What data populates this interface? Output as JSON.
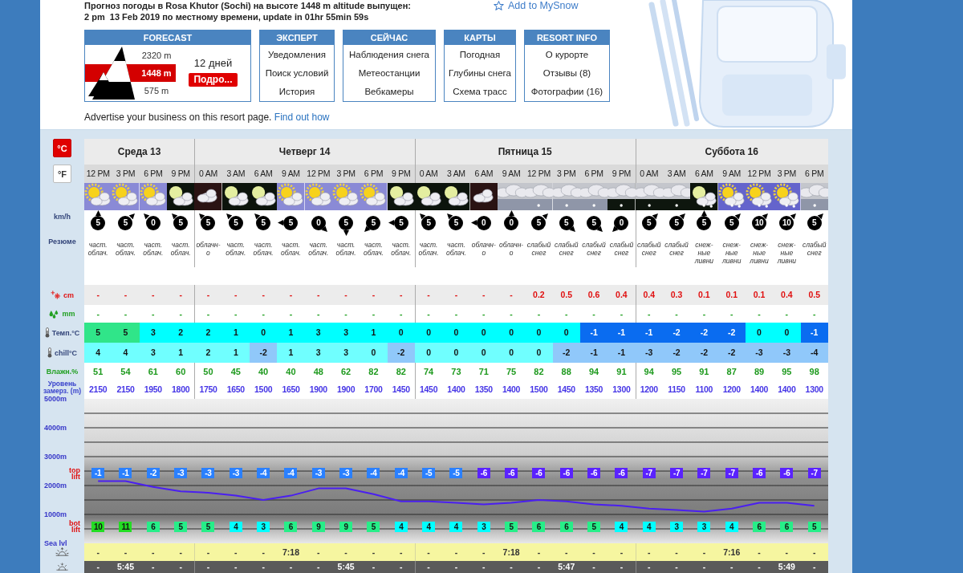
{
  "header": {
    "title": "Прогноз погоды в Rosa Khutor (Sochi) на высоте 1448 m altitude выпущен:",
    "issued": "2 pm  13 Feb 2019 по местному времени, update in 01hr 55min 59s",
    "mysnow_link": "Add to MySnow"
  },
  "forecast_box": {
    "title": "FORECAST",
    "altitudes": [
      {
        "label": "2320 m",
        "selected": false
      },
      {
        "label": "1448 m",
        "selected": true
      },
      {
        "label": "575 m",
        "selected": false
      }
    ],
    "days": "12 дней",
    "more_button": "Подро..."
  },
  "menus": [
    {
      "title": "ЭКСПЕРТ",
      "items": [
        "Уведомления",
        "Поиск условий",
        "История"
      ]
    },
    {
      "title": "СЕЙЧАС",
      "items": [
        "Наблюдения снега",
        "Метеостанции",
        "Вебкамеры"
      ]
    },
    {
      "title": "КАРТЫ",
      "items": [
        "Погодная",
        "Глубины снега",
        "Схема трасс"
      ]
    },
    {
      "title": "RESORT INFO",
      "items": [
        "О курорте",
        "Отзывы (8)",
        "Фотографии (16)"
      ]
    }
  ],
  "advert": {
    "text": "Advertise your business on this resort page.",
    "link": "Find out how"
  },
  "units": [
    {
      "label": "°C",
      "selected": true
    },
    {
      "label": "°F",
      "selected": false
    }
  ],
  "row_labels": {
    "wind": "km/h",
    "summary": "Резюме",
    "snow": "cm",
    "rain": "mm",
    "temp": "Темп.°C",
    "chill": "chill°C",
    "humidity": "Влажн.%",
    "freezing": "Уровень замерз. (m)"
  },
  "forecast": {
    "days": [
      {
        "name": "Среда 13",
        "columns": [
          {
            "time": "12 PM",
            "kind": "sun-cloud",
            "wind": {
              "speed": "5",
              "kind": "n"
            },
            "summary": "част. облач.",
            "snow": "-",
            "rain": "-",
            "temp": {
              "value": "5",
              "color": "#30e589"
            },
            "chill": {
              "value": "4",
              "color": "#70ffff"
            },
            "humidity": "51",
            "freezing": "2150"
          },
          {
            "time": "3 PM",
            "kind": "sun-cloud",
            "wind": {
              "speed": "5",
              "kind": "ne"
            },
            "summary": "част. облач.",
            "snow": "-",
            "rain": "-",
            "temp": {
              "value": "5",
              "color": "#30e589"
            },
            "chill": {
              "value": "4",
              "color": "#70ffff"
            },
            "humidity": "54",
            "freezing": "2150"
          },
          {
            "time": "6 PM",
            "kind": "sun-cloud",
            "wind": {
              "speed": "0",
              "kind": "nw"
            },
            "summary": "част. облач.",
            "snow": "-",
            "rain": "-",
            "temp": {
              "value": "3",
              "color": "#00ffff"
            },
            "chill": {
              "value": "3",
              "color": "#70ffff"
            },
            "humidity": "61",
            "freezing": "1950"
          },
          {
            "time": "9 PM",
            "kind": "moon-cloud",
            "wind": {
              "speed": "5",
              "kind": "nw"
            },
            "summary": "част. облач.",
            "snow": "-",
            "rain": "-",
            "temp": {
              "value": "2",
              "color": "#00ffff"
            },
            "chill": {
              "value": "1",
              "color": "#70ffff"
            },
            "humidity": "60",
            "freezing": "1800"
          }
        ]
      },
      {
        "name": "Четверг 14",
        "columns": [
          {
            "time": "0 AM",
            "kind": "cloud-night",
            "wind": {
              "speed": "5",
              "kind": "nw"
            },
            "summary": "облачн-о",
            "snow": "-",
            "rain": "-",
            "temp": {
              "value": "2",
              "color": "#00ffff"
            },
            "chill": {
              "value": "2",
              "color": "#70ffff"
            },
            "humidity": "50",
            "freezing": "1750"
          },
          {
            "time": "3 AM",
            "kind": "moon-cloud",
            "wind": {
              "speed": "5",
              "kind": "nw"
            },
            "summary": "част. облач.",
            "snow": "-",
            "rain": "-",
            "temp": {
              "value": "1",
              "color": "#00ffff"
            },
            "chill": {
              "value": "1",
              "color": "#70ffff"
            },
            "humidity": "45",
            "freezing": "1650"
          },
          {
            "time": "6 AM",
            "kind": "moon-cloud",
            "wind": {
              "speed": "5",
              "kind": "nw"
            },
            "summary": "част. облач.",
            "snow": "-",
            "rain": "-",
            "temp": {
              "value": "0",
              "color": "#00ffff"
            },
            "chill": {
              "value": "-2",
              "color": "#90c8fa"
            },
            "humidity": "40",
            "freezing": "1500"
          },
          {
            "time": "9 AM",
            "kind": "sun-cloud",
            "wind": {
              "speed": "5",
              "kind": "w"
            },
            "summary": "част. облач.",
            "snow": "-",
            "rain": "-",
            "temp": {
              "value": "1",
              "color": "#00ffff"
            },
            "chill": {
              "value": "1",
              "color": "#70ffff"
            },
            "humidity": "40",
            "freezing": "1650"
          },
          {
            "time": "12 PM",
            "kind": "sun-cloud",
            "wind": {
              "speed": "0",
              "kind": "se"
            },
            "summary": "част. облач.",
            "snow": "-",
            "rain": "-",
            "temp": {
              "value": "3",
              "color": "#00ffff"
            },
            "chill": {
              "value": "3",
              "color": "#70ffff"
            },
            "humidity": "48",
            "freezing": "1900"
          },
          {
            "time": "3 PM",
            "kind": "sun-cloud",
            "wind": {
              "speed": "5",
              "kind": "s"
            },
            "summary": "част. облач.",
            "snow": "-",
            "rain": "-",
            "temp": {
              "value": "3",
              "color": "#00ffff"
            },
            "chill": {
              "value": "3",
              "color": "#70ffff"
            },
            "humidity": "62",
            "freezing": "1900"
          },
          {
            "time": "6 PM",
            "kind": "sun-cloud",
            "wind": {
              "speed": "5",
              "kind": "sw"
            },
            "summary": "част. облач.",
            "snow": "-",
            "rain": "-",
            "temp": {
              "value": "1",
              "color": "#00ffff"
            },
            "chill": {
              "value": "0",
              "color": "#70ffff"
            },
            "humidity": "82",
            "freezing": "1700"
          },
          {
            "time": "9 PM",
            "kind": "moon-cloud",
            "wind": {
              "speed": "5",
              "kind": "w"
            },
            "summary": "част. облач.",
            "snow": "-",
            "rain": "-",
            "temp": {
              "value": "0",
              "color": "#00ffff"
            },
            "chill": {
              "value": "-2",
              "color": "#90c8fa"
            },
            "humidity": "82",
            "freezing": "1450"
          }
        ]
      },
      {
        "name": "Пятница 15",
        "columns": [
          {
            "time": "0 AM",
            "kind": "moon-cloud",
            "wind": {
              "speed": "5",
              "kind": "nw"
            },
            "summary": "част. облач.",
            "snow": "-",
            "rain": "-",
            "temp": {
              "value": "0",
              "color": "#00ffff"
            },
            "chill": {
              "value": "0",
              "color": "#70ffff"
            },
            "humidity": "74",
            "freezing": "1450"
          },
          {
            "time": "3 AM",
            "kind": "moon-cloud",
            "wind": {
              "speed": "5",
              "kind": "nw"
            },
            "summary": "част. облач.",
            "snow": "-",
            "rain": "-",
            "temp": {
              "value": "0",
              "color": "#00ffff"
            },
            "chill": {
              "value": "0",
              "color": "#70ffff"
            },
            "humidity": "73",
            "freezing": "1400"
          },
          {
            "time": "6 AM",
            "kind": "cloud-night",
            "wind": {
              "speed": "0",
              "kind": "w"
            },
            "summary": "облачн-о",
            "snow": "-",
            "rain": "-",
            "temp": {
              "value": "0",
              "color": "#00ffff"
            },
            "chill": {
              "value": "0",
              "color": "#70ffff"
            },
            "humidity": "71",
            "freezing": "1350"
          },
          {
            "time": "9 AM",
            "kind": "overcast",
            "wind": {
              "speed": "0",
              "kind": "n"
            },
            "summary": "облачн-о",
            "snow": "-",
            "rain": "-",
            "temp": {
              "value": "0",
              "color": "#00ffff"
            },
            "chill": {
              "value": "0",
              "color": "#70ffff"
            },
            "humidity": "75",
            "freezing": "1400"
          },
          {
            "time": "12 PM",
            "kind": "snow-day",
            "wind": {
              "speed": "5",
              "kind": "ne"
            },
            "summary": "слабый снег",
            "snow": "0.2",
            "rain": "-",
            "temp": {
              "value": "0",
              "color": "#00ffff"
            },
            "chill": {
              "value": "0",
              "color": "#70ffff"
            },
            "humidity": "82",
            "freezing": "1500"
          },
          {
            "time": "3 PM",
            "kind": "snow-day",
            "wind": {
              "speed": "5",
              "kind": "se"
            },
            "summary": "слабый снег",
            "snow": "0.5",
            "rain": "-",
            "temp": {
              "value": "0",
              "color": "#00ffff"
            },
            "chill": {
              "value": "-2",
              "color": "#90c8fa"
            },
            "humidity": "88",
            "freezing": "1450"
          },
          {
            "time": "6 PM",
            "kind": "snow-day",
            "wind": {
              "speed": "5",
              "kind": "se"
            },
            "summary": "слабый снег",
            "snow": "0.6",
            "rain": "-",
            "temp": {
              "value": "-1",
              "color": "#0a6cf0"
            },
            "chill": {
              "value": "-1",
              "color": "#90c8fa"
            },
            "humidity": "94",
            "freezing": "1350"
          },
          {
            "time": "9 PM",
            "kind": "snow-night",
            "wind": {
              "speed": "0",
              "kind": "sw"
            },
            "summary": "слабый снег",
            "snow": "0.4",
            "rain": "-",
            "temp": {
              "value": "-1",
              "color": "#0a6cf0"
            },
            "chill": {
              "value": "-1",
              "color": "#90c8fa"
            },
            "humidity": "91",
            "freezing": "1300"
          }
        ]
      },
      {
        "name": "Суббота 16",
        "columns": [
          {
            "time": "0 AM",
            "kind": "snow-night",
            "wind": {
              "speed": "5",
              "kind": "ne"
            },
            "summary": "слабый снег",
            "snow": "0.4",
            "rain": "-",
            "temp": {
              "value": "-1",
              "color": "#0a6cf0"
            },
            "chill": {
              "value": "-3",
              "color": "#90c8fa"
            },
            "humidity": "94",
            "freezing": "1200"
          },
          {
            "time": "3 AM",
            "kind": "snow-night",
            "wind": {
              "speed": "5",
              "kind": "ne"
            },
            "summary": "слабый снег",
            "snow": "0.3",
            "rain": "-",
            "temp": {
              "value": "-2",
              "color": "#0a6cf0"
            },
            "chill": {
              "value": "-2",
              "color": "#90c8fa"
            },
            "humidity": "95",
            "freezing": "1150"
          },
          {
            "time": "6 AM",
            "kind": "moon-snow",
            "wind": {
              "speed": "5",
              "kind": "n"
            },
            "summary": "снеж-ные ливни",
            "snow": "0.1",
            "rain": "-",
            "temp": {
              "value": "-2",
              "color": "#0a6cf0"
            },
            "chill": {
              "value": "-2",
              "color": "#90c8fa"
            },
            "humidity": "91",
            "freezing": "1100"
          },
          {
            "time": "9 AM",
            "kind": "sun-snow",
            "wind": {
              "speed": "5",
              "kind": "ne"
            },
            "summary": "снеж-ные ливни",
            "snow": "0.1",
            "rain": "-",
            "temp": {
              "value": "-2",
              "color": "#0a6cf0"
            },
            "chill": {
              "value": "-2",
              "color": "#90c8fa"
            },
            "humidity": "87",
            "freezing": "1200"
          },
          {
            "time": "12 PM",
            "kind": "sun-snow",
            "wind": {
              "speed": "10",
              "kind": "ne"
            },
            "summary": "снеж-ные ливни",
            "snow": "0.1",
            "rain": "-",
            "temp": {
              "value": "0",
              "color": "#00ffff"
            },
            "chill": {
              "value": "-3",
              "color": "#90c8fa"
            },
            "humidity": "89",
            "freezing": "1400"
          },
          {
            "time": "3 PM",
            "kind": "sun-snow",
            "wind": {
              "speed": "10",
              "kind": "ne"
            },
            "summary": "снеж-ные ливни",
            "snow": "0.4",
            "rain": "-",
            "temp": {
              "value": "0",
              "color": "#00ffff"
            },
            "chill": {
              "value": "-3",
              "color": "#90c8fa"
            },
            "humidity": "95",
            "freezing": "1400"
          },
          {
            "time": "6 PM",
            "kind": "snow-day",
            "wind": {
              "speed": "5",
              "kind": "ne"
            },
            "summary": "слабый снег",
            "snow": "0.5",
            "rain": "-",
            "temp": {
              "value": "-1",
              "color": "#0a6cf0"
            },
            "chill": {
              "value": "-4",
              "color": "#90c8fa"
            },
            "humidity": "98",
            "freezing": "1300"
          }
        ]
      }
    ]
  },
  "altitude_chart": {
    "chart_data": {
      "type": "line",
      "ylim": [
        0,
        5000
      ],
      "grid": true,
      "yticks": [
        {
          "value": 5000,
          "label": "5000m"
        },
        {
          "value": 4000,
          "label": "4000m"
        },
        {
          "value": 3000,
          "label": "3000m"
        },
        {
          "value": 2000,
          "label": "2000m"
        },
        {
          "value": 1000,
          "label": "1000m"
        },
        {
          "value": 0,
          "label": "Sea lvl"
        }
      ],
      "series": [
        {
          "color": "#4a1ff0",
          "values": [
            2150,
            2150,
            1950,
            1800,
            1750,
            1650,
            1500,
            1650,
            1900,
            1900,
            1700,
            1450,
            1450,
            1400,
            1350,
            1400,
            1500,
            1450,
            1350,
            1300,
            1200,
            1150,
            1100,
            1200,
            1400,
            1400,
            1300
          ]
        }
      ]
    },
    "top_lift": {
      "label": "top lift",
      "temps": [
        {
          "value": "-1",
          "color": "#2a80ff"
        },
        {
          "value": "-1",
          "color": "#2a80ff"
        },
        {
          "value": "-2",
          "color": "#2a80ff"
        },
        {
          "value": "-3",
          "color": "#2a80ff"
        },
        {
          "value": "-3",
          "color": "#2a80ff"
        },
        {
          "value": "-3",
          "color": "#2a80ff"
        },
        {
          "value": "-4",
          "color": "#2a80ff"
        },
        {
          "value": "-4",
          "color": "#2a80ff"
        },
        {
          "value": "-3",
          "color": "#2a80ff"
        },
        {
          "value": "-3",
          "color": "#2a80ff"
        },
        {
          "value": "-4",
          "color": "#2a80ff"
        },
        {
          "value": "-4",
          "color": "#2a80ff"
        },
        {
          "value": "-5",
          "color": "#2a80ff"
        },
        {
          "value": "-5",
          "color": "#2a80ff"
        },
        {
          "value": "-6",
          "color": "#5a22ff"
        },
        {
          "value": "-6",
          "color": "#5a22ff"
        },
        {
          "value": "-6",
          "color": "#5a22ff"
        },
        {
          "value": "-6",
          "color": "#5a22ff"
        },
        {
          "value": "-6",
          "color": "#5a22ff"
        },
        {
          "value": "-6",
          "color": "#5a22ff"
        },
        {
          "value": "-7",
          "color": "#5a22ff"
        },
        {
          "value": "-7",
          "color": "#5a22ff"
        },
        {
          "value": "-7",
          "color": "#5a22ff"
        },
        {
          "value": "-7",
          "color": "#5a22ff"
        },
        {
          "value": "-6",
          "color": "#5a22ff"
        },
        {
          "value": "-6",
          "color": "#5a22ff"
        },
        {
          "value": "-7",
          "color": "#5a22ff"
        }
      ]
    },
    "bottom_lift": {
      "label": "bot lift",
      "temps": [
        {
          "value": "10",
          "color": "#22dd22"
        },
        {
          "value": "11",
          "color": "#22dd22"
        },
        {
          "value": "6",
          "color": "#26ee88"
        },
        {
          "value": "5",
          "color": "#26ee88"
        },
        {
          "value": "5",
          "color": "#26ee88"
        },
        {
          "value": "4",
          "color": "#00ffff"
        },
        {
          "value": "3",
          "color": "#00ffff"
        },
        {
          "value": "6",
          "color": "#26ee88"
        },
        {
          "value": "9",
          "color": "#26ee88"
        },
        {
          "value": "9",
          "color": "#26ee88"
        },
        {
          "value": "5",
          "color": "#26ee88"
        },
        {
          "value": "4",
          "color": "#00ffff"
        },
        {
          "value": "4",
          "color": "#00ffff"
        },
        {
          "value": "4",
          "color": "#00ffff"
        },
        {
          "value": "3",
          "color": "#00ffff"
        },
        {
          "value": "5",
          "color": "#26ee88"
        },
        {
          "value": "6",
          "color": "#26ee88"
        },
        {
          "value": "6",
          "color": "#26ee88"
        },
        {
          "value": "5",
          "color": "#26ee88"
        },
        {
          "value": "4",
          "color": "#00ffff"
        },
        {
          "value": "4",
          "color": "#00ffff"
        },
        {
          "value": "3",
          "color": "#00ffff"
        },
        {
          "value": "3",
          "color": "#00ffff"
        },
        {
          "value": "4",
          "color": "#00ffff"
        },
        {
          "value": "6",
          "color": "#26ee88"
        },
        {
          "value": "6",
          "color": "#26ee88"
        },
        {
          "value": "5",
          "color": "#26ee88"
        }
      ]
    }
  },
  "sun_times": {
    "sunrise": [
      "-",
      "-",
      "-",
      "-",
      "-",
      "-",
      "-",
      "7:18",
      "-",
      "-",
      "-",
      "-",
      "-",
      "-",
      "-",
      "7:18",
      "-",
      "-",
      "-",
      "-",
      "-",
      "-",
      "-",
      "7:16",
      "-",
      "-",
      "-"
    ],
    "sunset": [
      "-",
      "5:45",
      "-",
      "-",
      "-",
      "-",
      "-",
      "-",
      "-",
      "5:45",
      "-",
      "-",
      "-",
      "-",
      "-",
      "-",
      "-",
      "5:47",
      "-",
      "-",
      "-",
      "-",
      "-",
      "-",
      "-",
      "5:49",
      "-"
    ]
  }
}
